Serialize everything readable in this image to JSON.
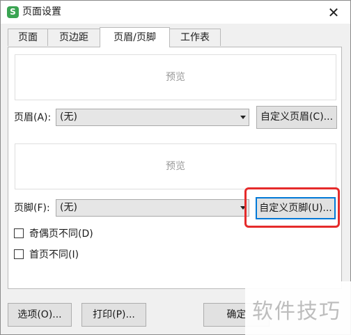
{
  "window": {
    "title": "页面设置",
    "app_icon": "S",
    "close_glyph": "✕"
  },
  "tabs": [
    {
      "label": "页面"
    },
    {
      "label": "页边距"
    },
    {
      "label": "页眉/页脚",
      "active": true
    },
    {
      "label": "工作表"
    }
  ],
  "header": {
    "preview": "预览",
    "label": "页眉(A):",
    "selected": "(无)",
    "custom_button": "自定义页眉(C)..."
  },
  "footer": {
    "preview": "预览",
    "label": "页脚(F):",
    "selected": "(无)",
    "custom_button": "自定义页脚(U)..."
  },
  "options": {
    "odd_even": {
      "label": "奇偶页不同(D)",
      "checked": false
    },
    "first_page": {
      "label": "首页不同(I)",
      "checked": false
    }
  },
  "buttons": {
    "options": "选项(O)...",
    "print": "打印(P)...",
    "ok": "确定"
  },
  "watermark": "软件技巧",
  "colors": {
    "highlight": "#e52b2b",
    "focus": "#0078d7",
    "app_icon": "#3aa452"
  }
}
